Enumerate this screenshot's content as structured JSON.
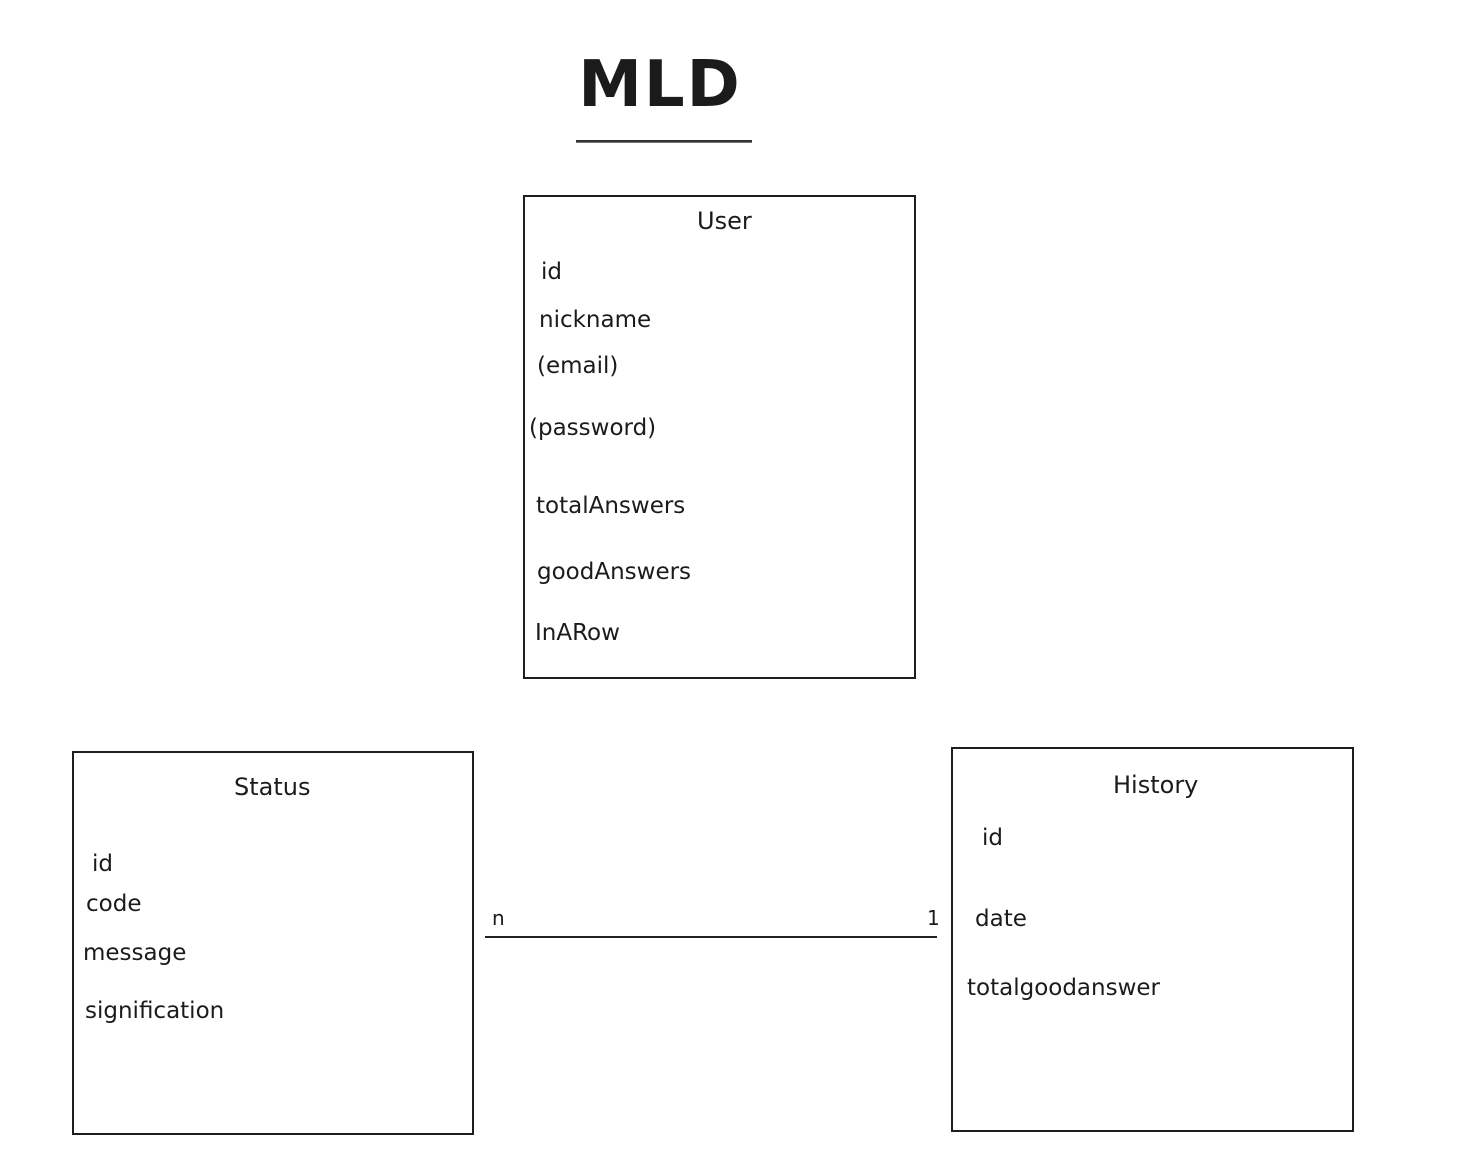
{
  "title": "MLD",
  "entities": {
    "user": {
      "name": "User",
      "attributes": [
        "id",
        "nickname",
        "(email)",
        "(password)",
        "totalAnswers",
        "goodAnswers",
        "InARow"
      ]
    },
    "status": {
      "name": "Status",
      "attributes": [
        "id",
        "code",
        "message",
        "signification"
      ]
    },
    "history": {
      "name": "History",
      "attributes": [
        "id",
        "date",
        "totalgoodanswer"
      ]
    }
  },
  "relation": {
    "left_cardinality": "n",
    "right_cardinality": "1"
  }
}
